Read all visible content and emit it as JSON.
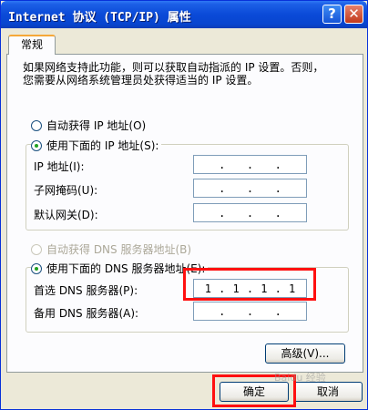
{
  "window": {
    "title": "Internet 协议 (TCP/IP) 属性",
    "help_label": "?",
    "close_label": "✕"
  },
  "tab": {
    "label": "常规"
  },
  "description": {
    "line1": "如果网络支持此功能，则可以获取自动指派的 IP 设置。否则，",
    "line2": "您需要从网络系统管理员处获得适当的 IP 设置。"
  },
  "ip_section": {
    "auto_label": "自动获得 IP 地址(O)",
    "manual_label": "使用下面的 IP 地址(S):",
    "auto_checked": false,
    "manual_checked": true,
    "fields": [
      {
        "label": "IP 地址(I):",
        "octets": [
          "",
          "",
          "",
          ""
        ]
      },
      {
        "label": "子网掩码(U):",
        "octets": [
          "",
          "",
          "",
          ""
        ]
      },
      {
        "label": "默认网关(D):",
        "octets": [
          "",
          "",
          "",
          ""
        ]
      }
    ]
  },
  "dns_section": {
    "auto_label": "自动获得 DNS 服务器地址(B)",
    "manual_label": "使用下面的 DNS 服务器地址(E):",
    "auto_disabled": true,
    "manual_checked": true,
    "fields": [
      {
        "label": "首选 DNS 服务器(P):",
        "octets": [
          "1",
          "1",
          "1",
          "1"
        ]
      },
      {
        "label": "备用 DNS 服务器(A):",
        "octets": [
          "",
          "",
          "",
          ""
        ]
      }
    ]
  },
  "buttons": {
    "advanced": "高级(V)...",
    "ok": "确定",
    "cancel": "取消"
  },
  "watermark": "Baidu 经验",
  "colors": {
    "highlight": "#ff1010",
    "titlebar": "#0a4ad8"
  }
}
